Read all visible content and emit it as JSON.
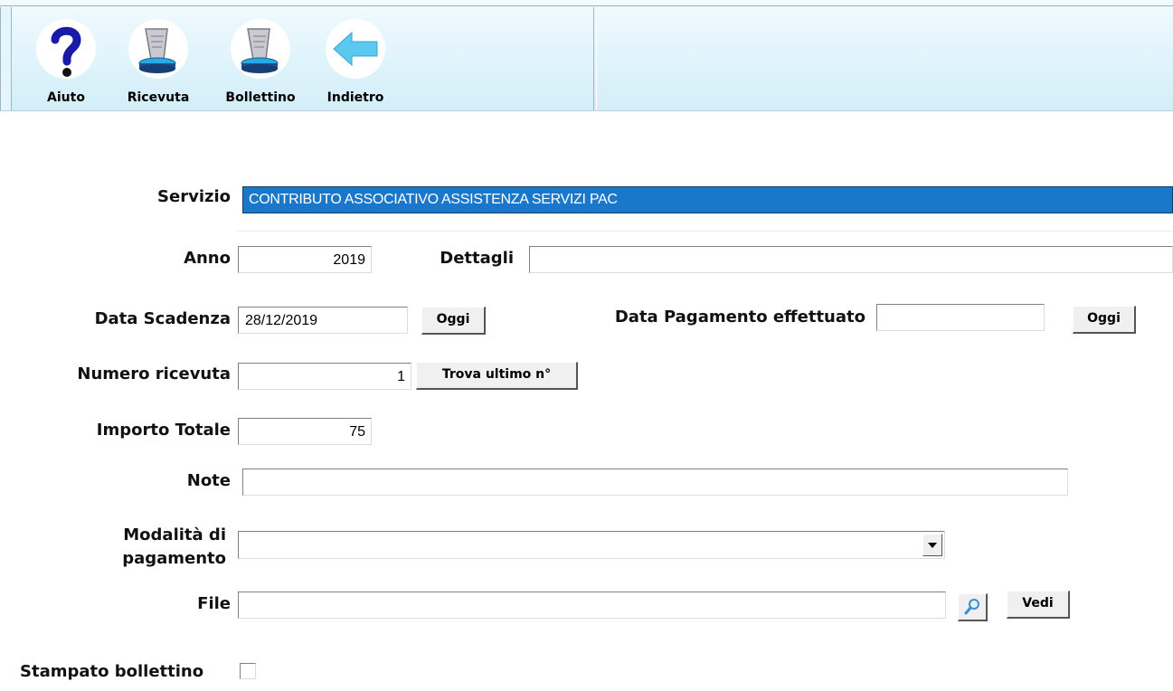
{
  "toolbar": {
    "buttons": [
      {
        "label": "Aiuto",
        "icon": "help-question-icon"
      },
      {
        "label": "Ricevuta",
        "icon": "receipt-printer-icon"
      },
      {
        "label": "Bollettino",
        "icon": "payment-slip-printer-icon"
      },
      {
        "label": "Indietro",
        "icon": "back-arrow-icon"
      }
    ]
  },
  "form": {
    "servizio": {
      "label": "Servizio",
      "value": "CONTRIBUTO ASSOCIATIVO ASSISTENZA SERVIZI PAC"
    },
    "anno": {
      "label": "Anno",
      "value": "2019"
    },
    "dettagli": {
      "label": "Dettagli",
      "value": ""
    },
    "data_scadenza": {
      "label": "Data Scadenza",
      "value": "28/12/2019",
      "button": "Oggi"
    },
    "data_pagamento": {
      "label": "Data Pagamento effettuato",
      "value": "",
      "button": "Oggi"
    },
    "numero_ricevuta": {
      "label": "Numero ricevuta",
      "value": "1",
      "button": "Trova ultimo n°"
    },
    "importo_totale": {
      "label": "Importo Totale",
      "value": "75"
    },
    "note": {
      "label": "Note",
      "value": ""
    },
    "modalita": {
      "label_line1": "Modalità di",
      "label_line2": "pagamento",
      "value": ""
    },
    "file": {
      "label": "File",
      "value": "",
      "button": "Vedi"
    },
    "stampato_bollettino": {
      "label": "Stampato bollettino",
      "checked": false
    }
  },
  "colors": {
    "selection_blue": "#1b77c9",
    "toolbar_bg": "#def3fb",
    "back_arrow": "#5bc8ee"
  }
}
